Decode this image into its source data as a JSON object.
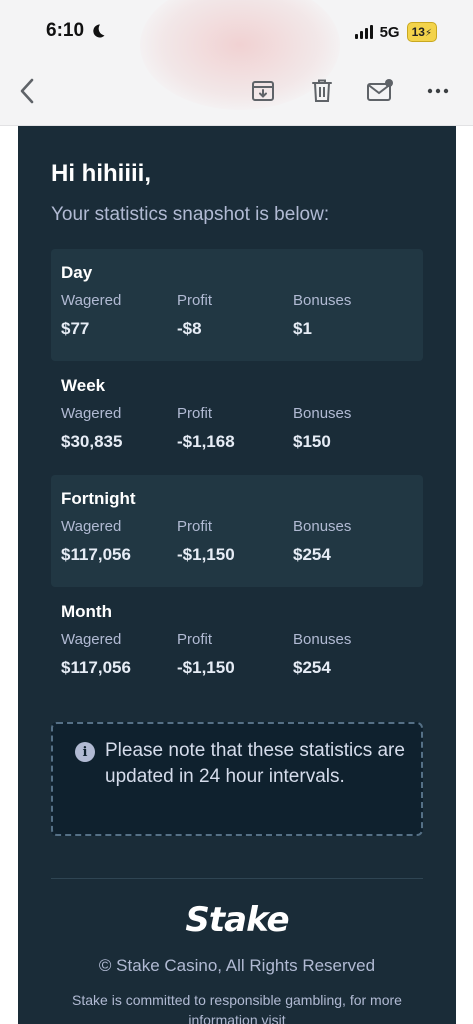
{
  "status_bar": {
    "time": "6:10",
    "network": "5G",
    "battery": "13"
  },
  "toolbar": {
    "back_icon": "chevron-left-icon",
    "archive_icon": "archive-icon",
    "trash_icon": "trash-icon",
    "mail_unread_icon": "mail-unread-icon",
    "more_icon": "more-icon"
  },
  "email": {
    "greeting": "Hi hihiiii,",
    "subtitle": "Your statistics snapshot is below:",
    "stat_labels": {
      "wagered": "Wagered",
      "profit": "Profit",
      "bonuses": "Bonuses"
    },
    "periods": [
      {
        "title": "Day",
        "wagered": "$77",
        "profit": "-$8",
        "bonuses": "$1"
      },
      {
        "title": "Week",
        "wagered": "$30,835",
        "profit": "-$1,168",
        "bonuses": "$150"
      },
      {
        "title": "Fortnight",
        "wagered": "$117,056",
        "profit": "-$1,150",
        "bonuses": "$254"
      },
      {
        "title": "Month",
        "wagered": "$117,056",
        "profit": "-$1,150",
        "bonuses": "$254"
      }
    ],
    "note": "Please note that these statistics are updated in 24 hour intervals.",
    "note_icon": "info-icon",
    "logo": "Stake",
    "copyright": "© Stake Casino, All Rights Reserved",
    "responsible": "Stake is committed to responsible gambling, for more information visit"
  },
  "colors": {
    "email_bg": "#1a2c38",
    "card_bg": "#213743",
    "label": "#b1bad3",
    "note_bg": "#0f212e"
  }
}
